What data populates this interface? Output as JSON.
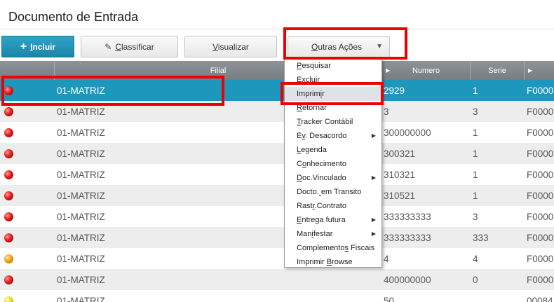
{
  "page": {
    "title": "Documento de Entrada"
  },
  "toolbar": {
    "incluir_label": "Incluir",
    "classificar_label": "Classificar",
    "visualizar_label": "Visualizar",
    "outras_label": "Outras Ações"
  },
  "grid": {
    "columns": [
      "",
      "Filial",
      "Numero",
      "Serie",
      ""
    ],
    "rows": [
      {
        "status": "red",
        "filial": "01-MATRIZ",
        "numero": "2929",
        "serie": "1",
        "fornecedor": "F0000",
        "selected": true
      },
      {
        "status": "red",
        "filial": "01-MATRIZ",
        "numero": "3",
        "serie": "3",
        "fornecedor": "F0000"
      },
      {
        "status": "red",
        "filial": "01-MATRIZ",
        "numero": "300000000",
        "serie": "1",
        "fornecedor": "F0000"
      },
      {
        "status": "red",
        "filial": "01-MATRIZ",
        "numero": "300321",
        "serie": "1",
        "fornecedor": "F0000"
      },
      {
        "status": "red",
        "filial": "01-MATRIZ",
        "numero": "310321",
        "serie": "1",
        "fornecedor": "F0000"
      },
      {
        "status": "red",
        "filial": "01-MATRIZ",
        "numero": "310521",
        "serie": "1",
        "fornecedor": "F0000"
      },
      {
        "status": "red",
        "filial": "01-MATRIZ",
        "numero": "333333333",
        "serie": "3",
        "fornecedor": "F0000"
      },
      {
        "status": "red",
        "filial": "01-MATRIZ",
        "numero": "333333333",
        "serie": "333",
        "fornecedor": "F0000"
      },
      {
        "status": "orange",
        "filial": "01-MATRIZ",
        "numero": "4",
        "serie": "4",
        "fornecedor": "F0000"
      },
      {
        "status": "red",
        "filial": "01-MATRIZ",
        "numero": "400000000",
        "serie": "0",
        "fornecedor": "F0000"
      },
      {
        "status": "yellow",
        "filial": "01-MATRIZ",
        "numero": "50",
        "serie": "",
        "fornecedor": "00084"
      }
    ]
  },
  "menu": {
    "items": [
      {
        "label": "Pesquisar",
        "ul": 0,
        "sub": false
      },
      {
        "label": "Excluir",
        "ul": 0,
        "sub": false
      },
      {
        "label": "Imprimir",
        "ul": 6,
        "sub": false,
        "hover": true
      },
      {
        "label": "Retornar",
        "ul": 0,
        "sub": false
      },
      {
        "label": "Tracker Contábil",
        "ul": 0,
        "sub": false
      },
      {
        "label": "Ev. Desacordo",
        "ul": 1,
        "sub": true
      },
      {
        "label": "Legenda",
        "ul": 0,
        "sub": false
      },
      {
        "label": "Conhecimento",
        "ul": 1,
        "sub": false
      },
      {
        "label": "Doc.Vinculado",
        "ul": 0,
        "sub": true
      },
      {
        "label": "Docto. em Transito",
        "ul": 6,
        "sub": false
      },
      {
        "label": "Rastr.Contrato",
        "ul": 4,
        "sub": false
      },
      {
        "label": "Entrega futura",
        "ul": 0,
        "sub": true
      },
      {
        "label": "Manifestar",
        "ul": 3,
        "sub": true
      },
      {
        "label": "Complementos Fiscais",
        "ul": 11,
        "sub": false
      },
      {
        "label": "Imprimir Browse",
        "ul": 9,
        "sub": false
      }
    ]
  }
}
